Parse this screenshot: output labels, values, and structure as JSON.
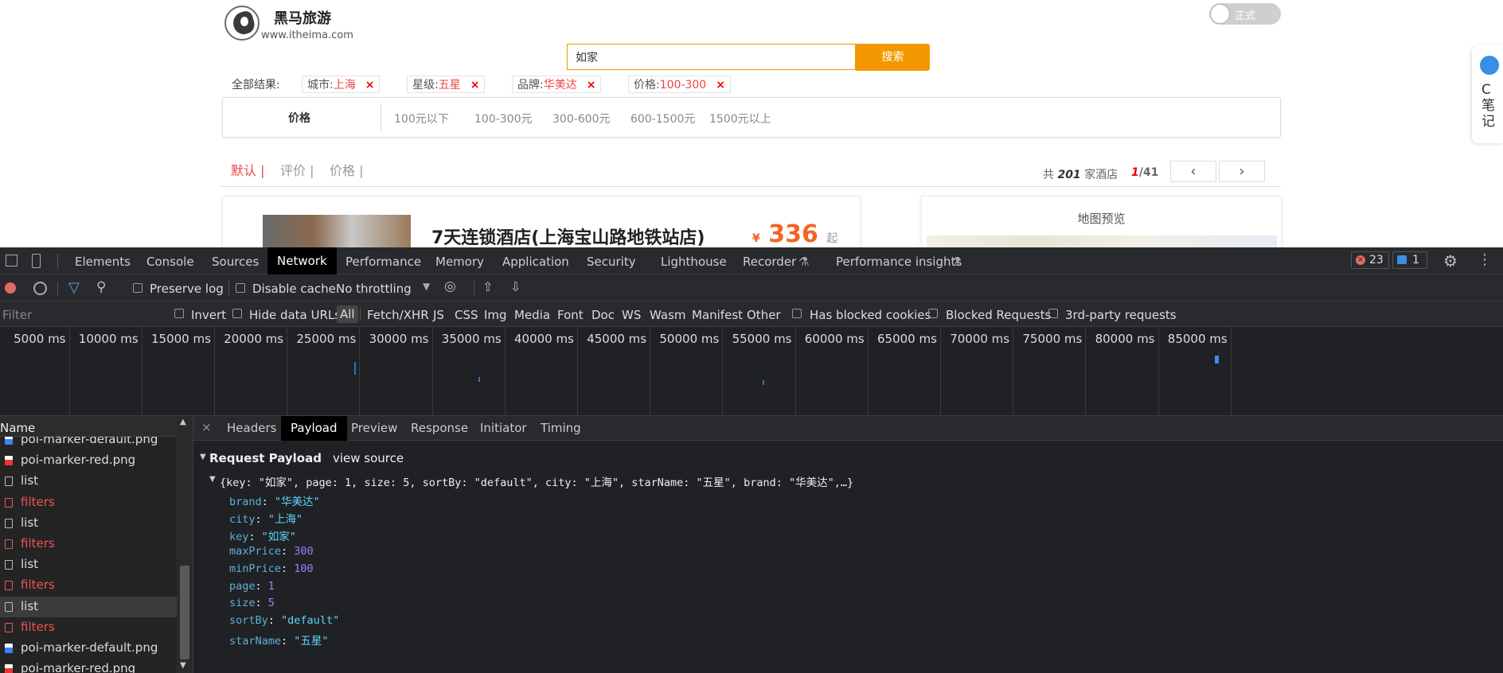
{
  "site": {
    "brand_name": "黑马旅游",
    "brand_url": "www.itheima.com",
    "toggle_label": "正式",
    "search_value": "如家",
    "search_button": "搜索",
    "all_results_label": "全部结果:",
    "filter_chips": [
      {
        "key": "城市:",
        "value": "上海",
        "close": "×"
      },
      {
        "key": "星级:",
        "value": "五星",
        "close": "×"
      },
      {
        "key": "品牌:",
        "value": "华美达",
        "close": "×"
      },
      {
        "key": "价格:",
        "value": "100-300",
        "close": "×"
      }
    ],
    "price_filter": {
      "label": "价格",
      "options": [
        "100元以下",
        "100-300元",
        "300-600元",
        "600-1500元",
        "1500元以上"
      ]
    },
    "sort_tabs": [
      "默认 |",
      "评价 |",
      "价格 |"
    ],
    "result_summary": {
      "prefix": "共",
      "count": "201",
      "suffix": "家酒店"
    },
    "pagination": {
      "current": "1",
      "total": "/41",
      "prev": "‹",
      "next": "›"
    },
    "hotel": {
      "name": "7天连锁酒店(上海宝山路地铁站店)",
      "currency": "¥",
      "price": "336",
      "suffix": "起"
    },
    "map_preview_title": "地图预览",
    "note_widget": {
      "text": "C笔记"
    }
  },
  "devtools": {
    "main_tabs": [
      "Elements",
      "Console",
      "Sources",
      "Network",
      "Performance",
      "Memory",
      "Application",
      "Security",
      "Lighthouse",
      "Recorder",
      "Performance insights"
    ],
    "active_main_tab": "Network",
    "error_count": "23",
    "message_count": "1",
    "toolbar": {
      "preserve_log": "Preserve log",
      "disable_cache": "Disable cache",
      "throttling": "No throttling"
    },
    "filter_bar": {
      "filter_placeholder": "Filter",
      "invert": "Invert",
      "hide_data_urls": "Hide data URLs",
      "types": [
        "All",
        "Fetch/XHR",
        "JS",
        "CSS",
        "Img",
        "Media",
        "Font",
        "Doc",
        "WS",
        "Wasm",
        "Manifest",
        "Other"
      ],
      "has_blocked_cookies": "Has blocked cookies",
      "blocked_requests": "Blocked Requests",
      "third_party": "3rd-party requests"
    },
    "timeline_labels": [
      "5000 ms",
      "10000 ms",
      "15000 ms",
      "20000 ms",
      "25000 ms",
      "30000 ms",
      "35000 ms",
      "40000 ms",
      "45000 ms",
      "50000 ms",
      "55000 ms",
      "60000 ms",
      "65000 ms",
      "70000 ms",
      "75000 ms",
      "80000 ms",
      "85000 ms"
    ],
    "requests_header": "Name",
    "requests": [
      {
        "name": "poi-marker-default.png",
        "kind": "png-blue"
      },
      {
        "name": "poi-marker-red.png",
        "kind": "png-red"
      },
      {
        "name": "list",
        "kind": "doc"
      },
      {
        "name": "filters",
        "kind": "error"
      },
      {
        "name": "list",
        "kind": "doc"
      },
      {
        "name": "filters",
        "kind": "error"
      },
      {
        "name": "list",
        "kind": "doc"
      },
      {
        "name": "filters",
        "kind": "error"
      },
      {
        "name": "list",
        "kind": "doc-selected"
      },
      {
        "name": "filters",
        "kind": "error"
      },
      {
        "name": "poi-marker-default.png",
        "kind": "png-blue"
      },
      {
        "name": "poi-marker-red.png",
        "kind": "png-red"
      }
    ],
    "detail_tabs": [
      "Headers",
      "Payload",
      "Preview",
      "Response",
      "Initiator",
      "Timing"
    ],
    "active_detail_tab": "Payload",
    "close_glyph": "×",
    "payload": {
      "section_title": "Request Payload",
      "view_source": "view source",
      "summary": "{key: \"如家\", page: 1, size: 5, sortBy: \"default\", city: \"上海\", starName: \"五星\", brand: \"华美达\",…}",
      "fields": [
        {
          "key": "brand",
          "value": "\"华美达\"",
          "type": "string"
        },
        {
          "key": "city",
          "value": "\"上海\"",
          "type": "string"
        },
        {
          "key": "key",
          "value": "\"如家\"",
          "type": "string"
        },
        {
          "key": "maxPrice",
          "value": "300",
          "type": "number"
        },
        {
          "key": "minPrice",
          "value": "100",
          "type": "number"
        },
        {
          "key": "page",
          "value": "1",
          "type": "number"
        },
        {
          "key": "size",
          "value": "5",
          "type": "number"
        },
        {
          "key": "sortBy",
          "value": "\"default\"",
          "type": "string"
        },
        {
          "key": "starName",
          "value": "\"五星\"",
          "type": "string"
        }
      ]
    }
  },
  "colors": {
    "accent_orange": "#f39800",
    "price_orange": "#f26522",
    "error_red": "#f0524f",
    "devtools_bg": "#242424"
  }
}
